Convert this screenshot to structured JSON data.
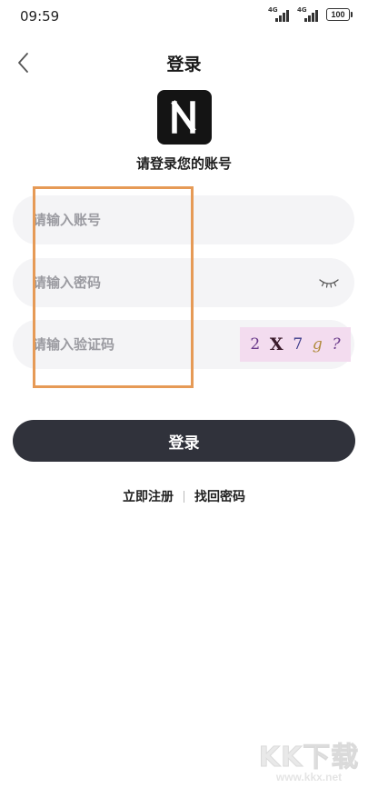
{
  "status_bar": {
    "time": "09:59",
    "network_1": "4G",
    "network_2": "4G",
    "battery": "100"
  },
  "header": {
    "title": "登录"
  },
  "logo": {
    "letter": "N"
  },
  "subtitle": "请登录您的账号",
  "form": {
    "account_placeholder": "请输入账号",
    "password_placeholder": "请输入密码",
    "captcha_placeholder": "请输入验证码",
    "captcha_chars": [
      "2",
      "X",
      "7",
      "g",
      "?"
    ]
  },
  "login_button": "登录",
  "links": {
    "register": "立即注册",
    "recover": "找回密码"
  },
  "watermark": {
    "text": "KK下载",
    "url": "www.kkx.net"
  },
  "colors": {
    "button_bg": "#30323b",
    "field_bg": "#f4f4f6",
    "highlight": "#e69a56",
    "captcha_bg": "#f3dcef"
  }
}
